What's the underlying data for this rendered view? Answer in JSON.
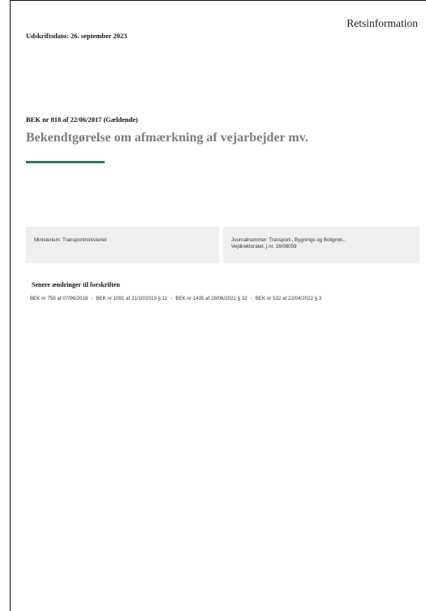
{
  "header": {
    "brand": "Retsinformation",
    "print_date": "Udskriftsdato: 26. september 2023"
  },
  "document": {
    "id_line": "BEK nr 818 af 22/06/2017 (Gældende)",
    "title": "Bekendtgørelse om afmærkning af vejarbejder mv.",
    "accent_color": "#2e7d4a"
  },
  "meta": {
    "ministry": "Ministerium: Transportministeriet",
    "journal_line1": "Journalnummer: Transport-, Bygnings og Boligmin.,",
    "journal_line2": "Vejdirektoratet, j.nr. 16/08059"
  },
  "amendments": {
    "heading": "Senere ændringer til forskriften",
    "items": [
      "BEK nr 759 af 07/06/2018",
      "BEK nr 1091 af 31/10/2019 § 11",
      "BEK nr 1435 af 28/06/2021 § 32",
      "BEK nr 532 af 22/04/2022 § 3"
    ],
    "separator": "-"
  }
}
